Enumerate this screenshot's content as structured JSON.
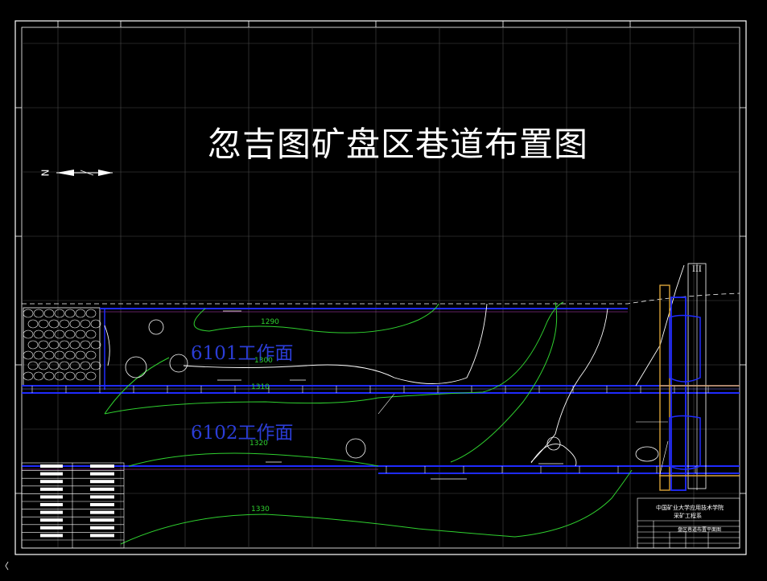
{
  "title": "忽吉图矿盘区巷道布置图",
  "faces": {
    "face1": "6101工作面",
    "face2": "6102工作面"
  },
  "contours": {
    "c1290": "1290",
    "c1300": "1300",
    "c1310": "1310",
    "c1320": "1320",
    "c1330": "1330"
  },
  "north_label": "N",
  "shaft_label": "III",
  "title_block": {
    "school": "中国矿业大学应用技术学院",
    "dept": "采矿工程系",
    "drawing_name": "盘区巷道布置平面图"
  },
  "colors": {
    "background": "#000000",
    "frame": "#ffffff",
    "grid": "#4a4a4a",
    "roadway": "#1f2bff",
    "contour": "#2fd12f",
    "shaft": "#d9a23a",
    "magenta": "#c040c0"
  }
}
